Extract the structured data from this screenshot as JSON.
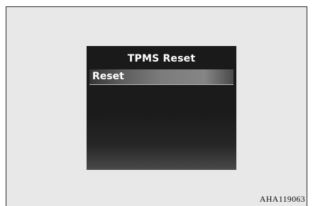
{
  "display": {
    "title": "TPMS Reset",
    "menu": {
      "items": [
        {
          "label": "Reset",
          "selected": true
        }
      ]
    }
  },
  "figure": {
    "reference_code": "AHA119063"
  },
  "colors": {
    "frame_background": "#e8e8e8",
    "screen_background": "#1a1a1a",
    "highlight": "#7c7c7c",
    "text": "#ffffff"
  }
}
